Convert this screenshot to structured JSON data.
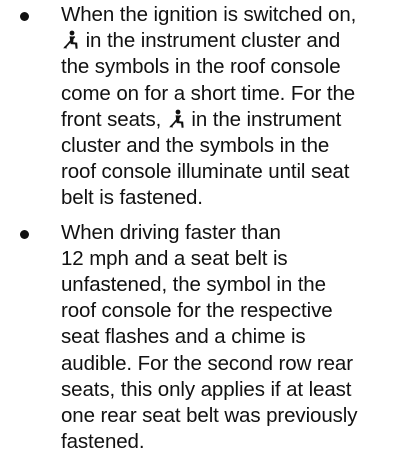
{
  "items": [
    {
      "lines": [
        {
          "text": "When the ignition is switched on,"
        },
        {
          "icon": "seatbelt-reminder-icon",
          "text": " in the instrument cluster and"
        },
        {
          "text": "the symbols in the roof console"
        },
        {
          "text": "come on for a short time. For the"
        },
        {
          "before": "front seats, ",
          "icon": "seatbelt-reminder-icon",
          "after": " in the instrument"
        },
        {
          "text": "cluster and the symbols in the"
        },
        {
          "text": "roof console illuminate until seat"
        },
        {
          "text": "belt is fastened."
        }
      ]
    },
    {
      "lines": [
        {
          "text": "When driving faster than"
        },
        {
          "text": "12 mph and a seat belt is"
        },
        {
          "text": "unfastened, the symbol in the"
        },
        {
          "text": "roof console for the respective"
        },
        {
          "text": "seat flashes and a chime is"
        },
        {
          "text": "audible. For the second row rear"
        },
        {
          "text": "seats, this only applies if at least"
        },
        {
          "text": "one rear seat belt was previously"
        },
        {
          "text": "fastened."
        }
      ]
    }
  ]
}
